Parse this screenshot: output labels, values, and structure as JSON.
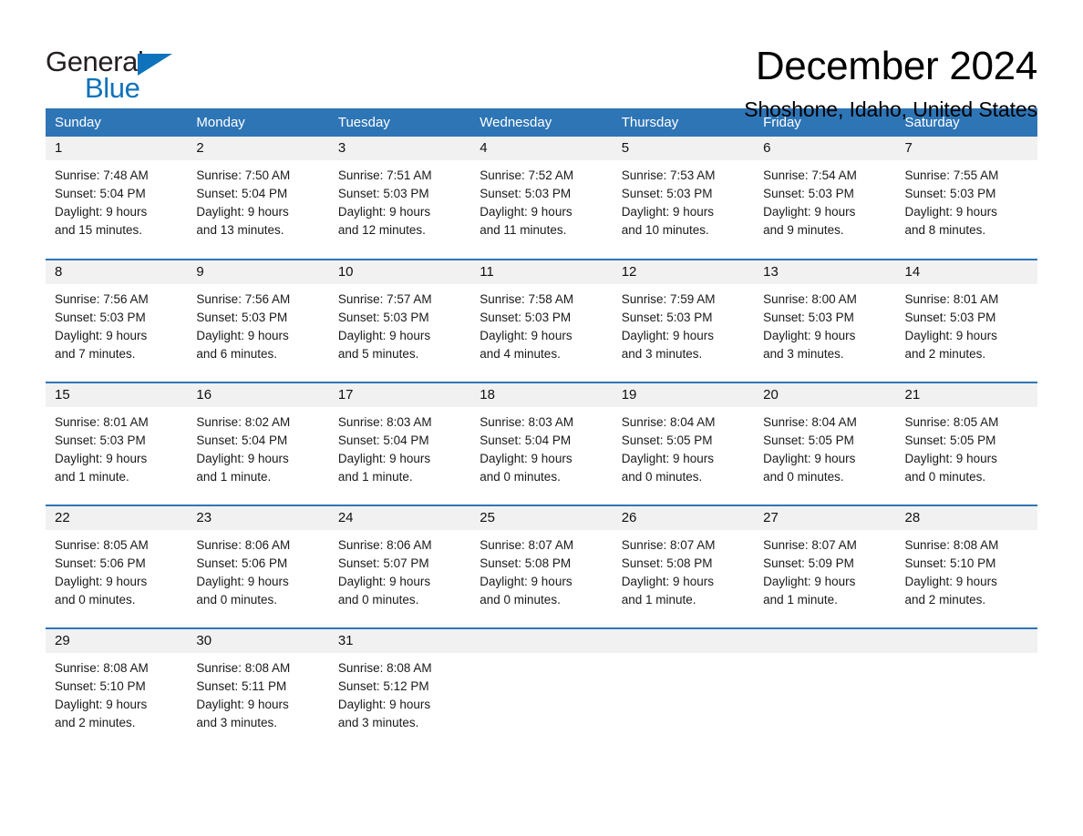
{
  "brand": {
    "name_part1": "General",
    "name_part2": "Blue",
    "accent_color": "#0e72bc"
  },
  "header": {
    "month_title": "December 2024",
    "location": "Shoshone, Idaho, United States",
    "header_bar_color": "#2e75b6",
    "daynum_band_color": "#f1f1f1"
  },
  "weekday_headers": [
    "Sunday",
    "Monday",
    "Tuesday",
    "Wednesday",
    "Thursday",
    "Friday",
    "Saturday"
  ],
  "weeks": [
    [
      {
        "day": "1",
        "sunrise": "Sunrise: 7:48 AM",
        "sunset": "Sunset: 5:04 PM",
        "daylight1": "Daylight: 9 hours",
        "daylight2": "and 15 minutes."
      },
      {
        "day": "2",
        "sunrise": "Sunrise: 7:50 AM",
        "sunset": "Sunset: 5:04 PM",
        "daylight1": "Daylight: 9 hours",
        "daylight2": "and 13 minutes."
      },
      {
        "day": "3",
        "sunrise": "Sunrise: 7:51 AM",
        "sunset": "Sunset: 5:03 PM",
        "daylight1": "Daylight: 9 hours",
        "daylight2": "and 12 minutes."
      },
      {
        "day": "4",
        "sunrise": "Sunrise: 7:52 AM",
        "sunset": "Sunset: 5:03 PM",
        "daylight1": "Daylight: 9 hours",
        "daylight2": "and 11 minutes."
      },
      {
        "day": "5",
        "sunrise": "Sunrise: 7:53 AM",
        "sunset": "Sunset: 5:03 PM",
        "daylight1": "Daylight: 9 hours",
        "daylight2": "and 10 minutes."
      },
      {
        "day": "6",
        "sunrise": "Sunrise: 7:54 AM",
        "sunset": "Sunset: 5:03 PM",
        "daylight1": "Daylight: 9 hours",
        "daylight2": "and 9 minutes."
      },
      {
        "day": "7",
        "sunrise": "Sunrise: 7:55 AM",
        "sunset": "Sunset: 5:03 PM",
        "daylight1": "Daylight: 9 hours",
        "daylight2": "and 8 minutes."
      }
    ],
    [
      {
        "day": "8",
        "sunrise": "Sunrise: 7:56 AM",
        "sunset": "Sunset: 5:03 PM",
        "daylight1": "Daylight: 9 hours",
        "daylight2": "and 7 minutes."
      },
      {
        "day": "9",
        "sunrise": "Sunrise: 7:56 AM",
        "sunset": "Sunset: 5:03 PM",
        "daylight1": "Daylight: 9 hours",
        "daylight2": "and 6 minutes."
      },
      {
        "day": "10",
        "sunrise": "Sunrise: 7:57 AM",
        "sunset": "Sunset: 5:03 PM",
        "daylight1": "Daylight: 9 hours",
        "daylight2": "and 5 minutes."
      },
      {
        "day": "11",
        "sunrise": "Sunrise: 7:58 AM",
        "sunset": "Sunset: 5:03 PM",
        "daylight1": "Daylight: 9 hours",
        "daylight2": "and 4 minutes."
      },
      {
        "day": "12",
        "sunrise": "Sunrise: 7:59 AM",
        "sunset": "Sunset: 5:03 PM",
        "daylight1": "Daylight: 9 hours",
        "daylight2": "and 3 minutes."
      },
      {
        "day": "13",
        "sunrise": "Sunrise: 8:00 AM",
        "sunset": "Sunset: 5:03 PM",
        "daylight1": "Daylight: 9 hours",
        "daylight2": "and 3 minutes."
      },
      {
        "day": "14",
        "sunrise": "Sunrise: 8:01 AM",
        "sunset": "Sunset: 5:03 PM",
        "daylight1": "Daylight: 9 hours",
        "daylight2": "and 2 minutes."
      }
    ],
    [
      {
        "day": "15",
        "sunrise": "Sunrise: 8:01 AM",
        "sunset": "Sunset: 5:03 PM",
        "daylight1": "Daylight: 9 hours",
        "daylight2": "and 1 minute."
      },
      {
        "day": "16",
        "sunrise": "Sunrise: 8:02 AM",
        "sunset": "Sunset: 5:04 PM",
        "daylight1": "Daylight: 9 hours",
        "daylight2": "and 1 minute."
      },
      {
        "day": "17",
        "sunrise": "Sunrise: 8:03 AM",
        "sunset": "Sunset: 5:04 PM",
        "daylight1": "Daylight: 9 hours",
        "daylight2": "and 1 minute."
      },
      {
        "day": "18",
        "sunrise": "Sunrise: 8:03 AM",
        "sunset": "Sunset: 5:04 PM",
        "daylight1": "Daylight: 9 hours",
        "daylight2": "and 0 minutes."
      },
      {
        "day": "19",
        "sunrise": "Sunrise: 8:04 AM",
        "sunset": "Sunset: 5:05 PM",
        "daylight1": "Daylight: 9 hours",
        "daylight2": "and 0 minutes."
      },
      {
        "day": "20",
        "sunrise": "Sunrise: 8:04 AM",
        "sunset": "Sunset: 5:05 PM",
        "daylight1": "Daylight: 9 hours",
        "daylight2": "and 0 minutes."
      },
      {
        "day": "21",
        "sunrise": "Sunrise: 8:05 AM",
        "sunset": "Sunset: 5:05 PM",
        "daylight1": "Daylight: 9 hours",
        "daylight2": "and 0 minutes."
      }
    ],
    [
      {
        "day": "22",
        "sunrise": "Sunrise: 8:05 AM",
        "sunset": "Sunset: 5:06 PM",
        "daylight1": "Daylight: 9 hours",
        "daylight2": "and 0 minutes."
      },
      {
        "day": "23",
        "sunrise": "Sunrise: 8:06 AM",
        "sunset": "Sunset: 5:06 PM",
        "daylight1": "Daylight: 9 hours",
        "daylight2": "and 0 minutes."
      },
      {
        "day": "24",
        "sunrise": "Sunrise: 8:06 AM",
        "sunset": "Sunset: 5:07 PM",
        "daylight1": "Daylight: 9 hours",
        "daylight2": "and 0 minutes."
      },
      {
        "day": "25",
        "sunrise": "Sunrise: 8:07 AM",
        "sunset": "Sunset: 5:08 PM",
        "daylight1": "Daylight: 9 hours",
        "daylight2": "and 0 minutes."
      },
      {
        "day": "26",
        "sunrise": "Sunrise: 8:07 AM",
        "sunset": "Sunset: 5:08 PM",
        "daylight1": "Daylight: 9 hours",
        "daylight2": "and 1 minute."
      },
      {
        "day": "27",
        "sunrise": "Sunrise: 8:07 AM",
        "sunset": "Sunset: 5:09 PM",
        "daylight1": "Daylight: 9 hours",
        "daylight2": "and 1 minute."
      },
      {
        "day": "28",
        "sunrise": "Sunrise: 8:08 AM",
        "sunset": "Sunset: 5:10 PM",
        "daylight1": "Daylight: 9 hours",
        "daylight2": "and 2 minutes."
      }
    ],
    [
      {
        "day": "29",
        "sunrise": "Sunrise: 8:08 AM",
        "sunset": "Sunset: 5:10 PM",
        "daylight1": "Daylight: 9 hours",
        "daylight2": "and 2 minutes."
      },
      {
        "day": "30",
        "sunrise": "Sunrise: 8:08 AM",
        "sunset": "Sunset: 5:11 PM",
        "daylight1": "Daylight: 9 hours",
        "daylight2": "and 3 minutes."
      },
      {
        "day": "31",
        "sunrise": "Sunrise: 8:08 AM",
        "sunset": "Sunset: 5:12 PM",
        "daylight1": "Daylight: 9 hours",
        "daylight2": "and 3 minutes."
      },
      {
        "day": "",
        "sunrise": "",
        "sunset": "",
        "daylight1": "",
        "daylight2": ""
      },
      {
        "day": "",
        "sunrise": "",
        "sunset": "",
        "daylight1": "",
        "daylight2": ""
      },
      {
        "day": "",
        "sunrise": "",
        "sunset": "",
        "daylight1": "",
        "daylight2": ""
      },
      {
        "day": "",
        "sunrise": "",
        "sunset": "",
        "daylight1": "",
        "daylight2": ""
      }
    ]
  ]
}
